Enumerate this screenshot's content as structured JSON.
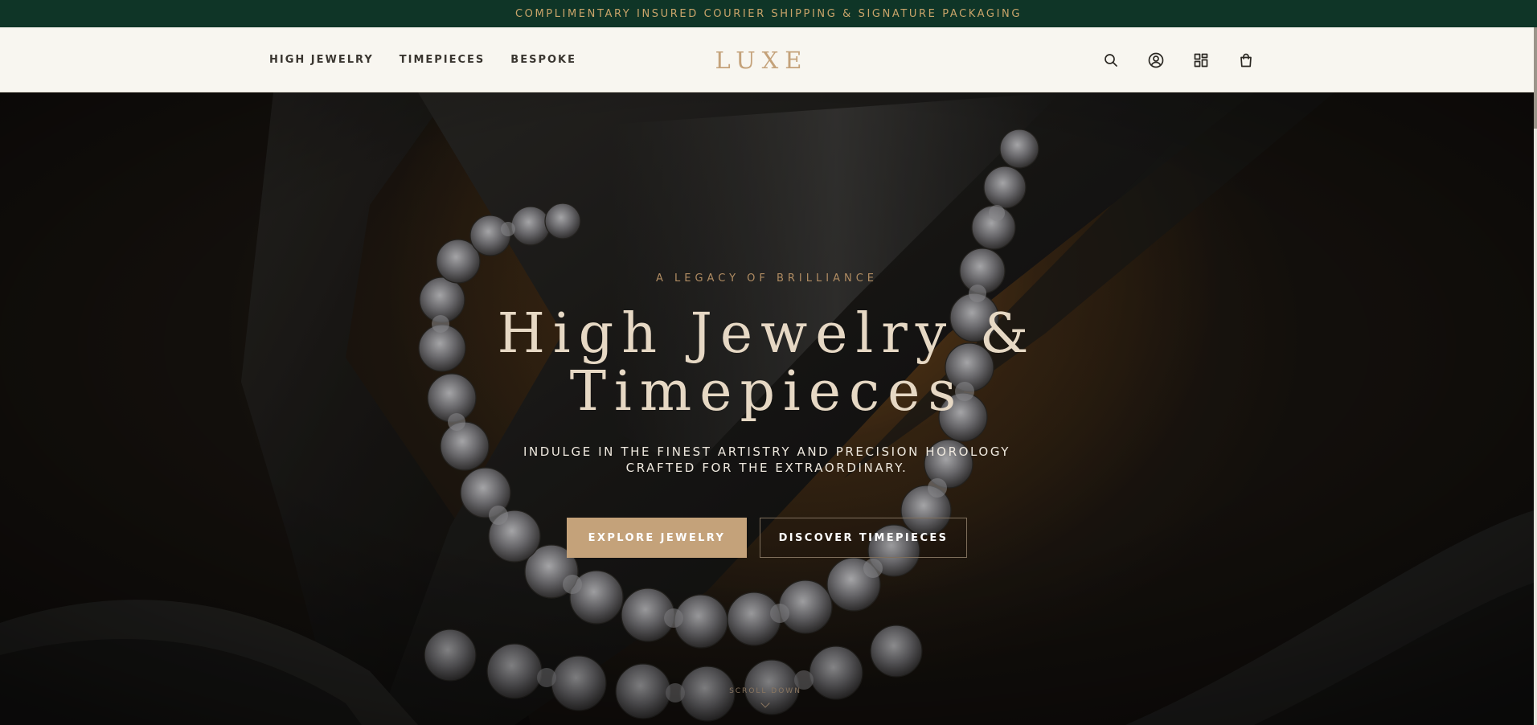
{
  "announcement": "COMPLIMENTARY INSURED COURIER SHIPPING & SIGNATURE PACKAGING",
  "header": {
    "nav": [
      "HIGH JEWELRY",
      "TIMEPIECES",
      "BESPOKE"
    ],
    "logo": "LUXE",
    "icons": [
      "search-icon",
      "account-icon",
      "grid-icon",
      "shopping-bag-icon"
    ]
  },
  "hero": {
    "eyebrow": "A LEGACY OF BRILLIANCE",
    "title_line1": "High Jewelry &",
    "title_line2": "Timepieces",
    "subtitle_line1": "INDULGE IN THE FINEST ARTISTRY AND PRECISION HOROLOGY",
    "subtitle_line2": "CRAFTED FOR THE EXTRAORDINARY.",
    "primary_cta": "EXPLORE JEWELRY",
    "secondary_cta": "DISCOVER TIMEPIECES",
    "scroll_label": "SCROLL DOWN"
  },
  "colors": {
    "announcement_bg": "#0f3527",
    "gold": "#c4a27a",
    "header_bg": "#f8f6f0"
  }
}
